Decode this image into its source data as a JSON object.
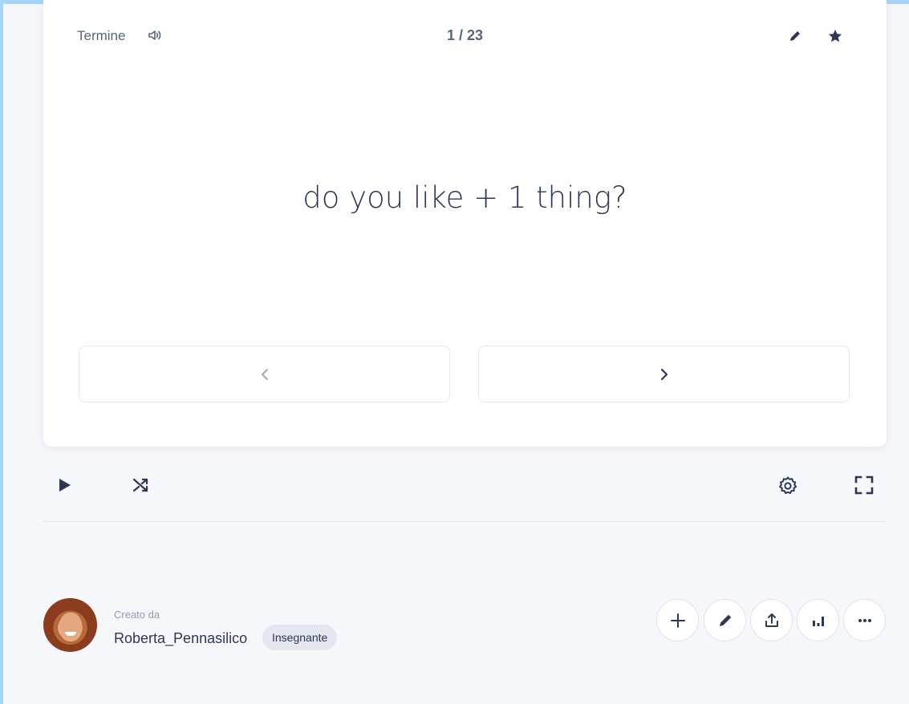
{
  "card": {
    "side_label": "Termine",
    "counter": "1 / 23",
    "term": "do you like + 1 thing?"
  },
  "author": {
    "created_label": "Creato da",
    "username": "Roberta_Pennasilico",
    "role": "Insegnante"
  },
  "icons": {
    "audio": "speaker-icon",
    "edit": "pencil-icon",
    "star": "star-icon",
    "prev": "chevron-left-icon",
    "next": "chevron-right-icon",
    "play": "play-icon",
    "shuffle": "shuffle-icon",
    "settings": "gear-icon",
    "fullscreen": "fullscreen-icon",
    "add": "plus-icon",
    "share": "upload-icon",
    "stats": "bar-chart-icon",
    "more": "more-icon"
  },
  "colors": {
    "background": "#f6f7fb",
    "card": "#ffffff",
    "text": "#2e3856",
    "muted": "#586380",
    "frame": "#a8d4f7"
  }
}
